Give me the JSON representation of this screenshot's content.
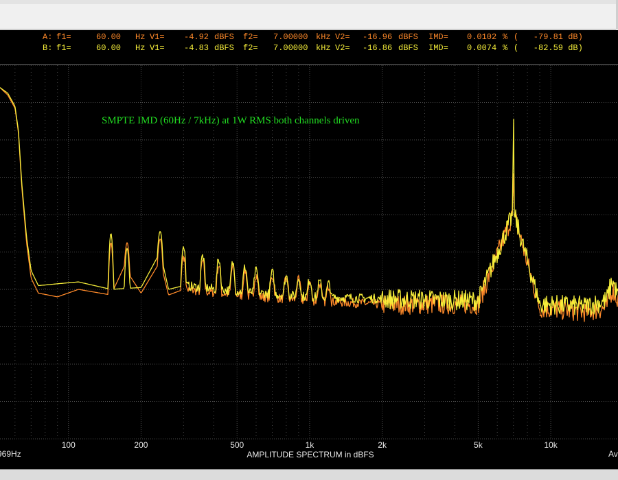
{
  "readout": {
    "a": {
      "ch": "A:",
      "f1_label": "f1=",
      "f1": "60.00",
      "f1_unit": "Hz",
      "v1_label": "V1=",
      "v1": "-4.92",
      "v1_unit": "dBFS",
      "f2_label": "f2=",
      "f2": "7.00000",
      "f2_unit": "kHz",
      "v2_label": "V2=",
      "v2": "-16.96",
      "v2_unit": "dBFS",
      "imd_label": "IMD=",
      "imd": "0.0102",
      "imd_unit": "%",
      "db": "(   -79.81 dB)"
    },
    "b": {
      "ch": "B:",
      "f1_label": "f1=",
      "f1": "60.00",
      "f1_unit": "Hz",
      "v1_label": "V1=",
      "v1": "-4.83",
      "v1_unit": "dBFS",
      "f2_label": "f2=",
      "f2": "7.00000",
      "f2_unit": "kHz",
      "v2_label": "V2=",
      "v2": "-16.86",
      "v2_unit": "dBFS",
      "imd_label": "IMD=",
      "imd": "0.0074",
      "imd_unit": "%",
      "db": "(   -82.59 dB)"
    }
  },
  "colors": {
    "channel_a": "#ff8a2a",
    "channel_b": "#f6ee3a",
    "annotation": "#22dd22",
    "grid": "#4a4a4a",
    "axis_text": "#e8e8e8"
  },
  "chart_data": {
    "type": "line",
    "title": "",
    "annotation": "SMPTE IMD (60Hz / 7kHz)  at 1W RMS both channels driven",
    "xlabel": "AMPLITUDE SPECTRUM in dBFS",
    "x_scale": "log",
    "xlim": [
      52,
      19000
    ],
    "ylim": [
      -20,
      0
    ],
    "x_ticks": [
      100,
      200,
      500,
      1000,
      2000,
      5000,
      10000
    ],
    "x_tick_labels": [
      "100",
      "200",
      "500",
      "1k",
      "2k",
      "5k",
      "10k"
    ],
    "x_edge_labels": {
      "left": "969Hz",
      "right": "Av"
    },
    "grid": true,
    "legend": "none",
    "noise_floor": {
      "a": -12.4,
      "b": -12.1
    },
    "series": [
      {
        "channel": "a",
        "x": [
          52,
          56,
          60,
          62,
          64,
          67,
          70,
          75,
          90,
          110,
          150,
          170,
          200,
          240,
          260,
          300,
          500,
          1000,
          2000,
          5000,
          6950,
          7000,
          7050,
          9000,
          14000,
          17000,
          18000,
          19000
        ],
        "y": [
          -1.2,
          -1.6,
          -2.3,
          -3.6,
          -6.5,
          -9.5,
          -11.4,
          -12.2,
          -12.4,
          -12.0,
          -12.3,
          -10.8,
          -12.2,
          -10.5,
          -12.3,
          -12.0,
          -12.3,
          -12.6,
          -12.8,
          -12.8,
          -8.0,
          -5.0,
          -8.0,
          -13.0,
          -13.2,
          -13.0,
          -12.0,
          -12.6
        ]
      },
      {
        "channel": "b",
        "x": [
          52,
          56,
          60,
          62,
          64,
          67,
          70,
          75,
          90,
          110,
          150,
          200,
          240,
          260,
          300,
          500,
          1000,
          2000,
          5000,
          6950,
          7000,
          7050,
          9000,
          14000,
          17000,
          18000,
          19000
        ],
        "y": [
          -1.2,
          -1.5,
          -2.2,
          -3.5,
          -6.3,
          -9.2,
          -11.0,
          -11.8,
          -11.7,
          -11.6,
          -12.0,
          -11.9,
          -10.0,
          -12.0,
          -11.8,
          -12.1,
          -12.4,
          -12.5,
          -12.6,
          -8.0,
          -1.0,
          -8.0,
          -12.8,
          -12.9,
          -12.6,
          -11.5,
          -12.4
        ]
      }
    ],
    "peaks": {
      "a": {
        "x": [
          150,
          175,
          240,
          300,
          360,
          420,
          480,
          540,
          600,
          700,
          800,
          900,
          1000,
          1100,
          1200
        ],
        "y": [
          -9.5,
          -9.5,
          -9.3,
          -10.2,
          -10.5,
          -10.7,
          -10.8,
          -11.0,
          -11.2,
          -11.3,
          -11.4,
          -11.5,
          -11.6,
          -11.7,
          -11.8
        ]
      },
      "b": {
        "x": [
          150,
          175,
          240,
          300,
          360,
          420,
          480,
          540,
          600,
          700,
          800,
          900,
          1000,
          1100,
          1200
        ],
        "y": [
          -9.0,
          -9.8,
          -8.9,
          -9.7,
          -10.2,
          -10.4,
          -10.6,
          -10.8,
          -11.0,
          -11.1,
          -11.3,
          -11.4,
          -11.5,
          -11.6,
          -11.7
        ]
      }
    }
  }
}
